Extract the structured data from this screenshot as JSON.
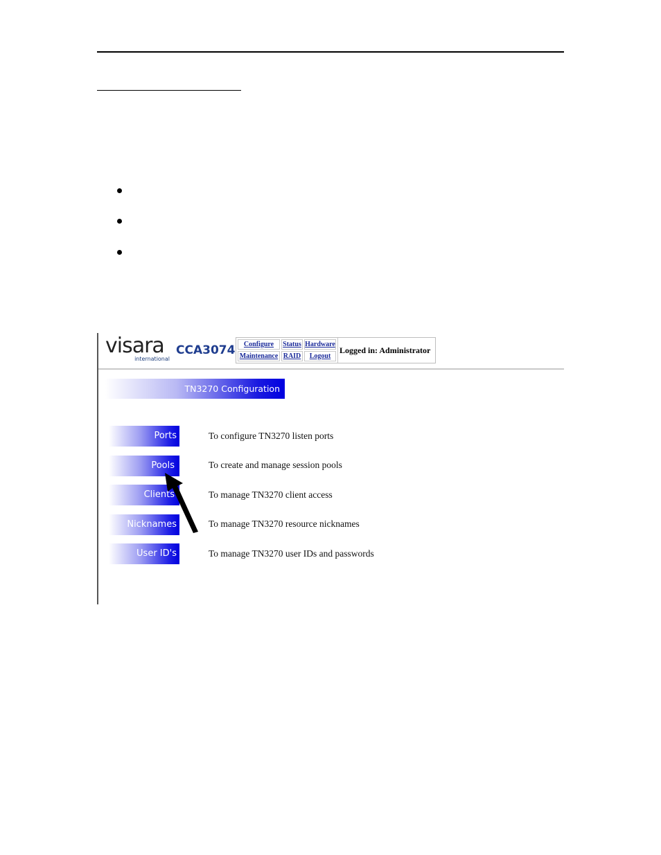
{
  "app": {
    "logo_text": "visara",
    "logo_subtext": "international",
    "product": "CCA3074"
  },
  "nav": {
    "configure": "Configure",
    "status": "Status",
    "hardware": "Hardware",
    "maintenance": "Maintenance",
    "raid": "RAID",
    "logout": "Logout",
    "logged_in_label": "Logged in:",
    "logged_in_user": "Administrator"
  },
  "page": {
    "title": "TN3270 Configuration"
  },
  "menu": [
    {
      "label": "Ports",
      "description": "To configure TN3270 listen ports"
    },
    {
      "label": "Pools",
      "description": "To create and manage session pools"
    },
    {
      "label": "Clients",
      "description": "To manage TN3270 client access"
    },
    {
      "label": "Nicknames",
      "description": "To manage TN3270 resource nicknames"
    },
    {
      "label": "User ID's",
      "description": "To manage TN3270 user IDs and passwords"
    }
  ],
  "icons": {
    "pointer": "arrow-pointer-icon",
    "bullet": "bullet-icon"
  }
}
